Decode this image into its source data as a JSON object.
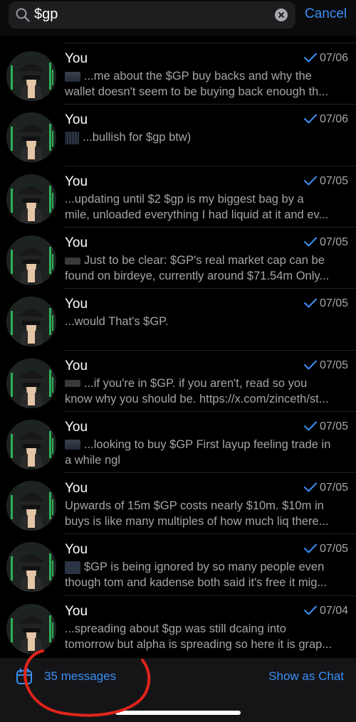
{
  "search": {
    "query": "$gp",
    "cancel_label": "Cancel"
  },
  "results": [
    {
      "sender": "You",
      "date": "07/06",
      "thumb": "t1",
      "text": "...me about the $GP buy backs and why the\nwallet doesn't seem to be buying back enough th..."
    },
    {
      "sender": "You",
      "date": "07/06",
      "thumb": "t2",
      "text": "...bullish for $gp btw)"
    },
    {
      "sender": "You",
      "date": "07/05",
      "thumb": "",
      "text": "...updating until $2 $gp is my biggest bag by a\nmile, unloaded everything I had liquid at it and ev..."
    },
    {
      "sender": "You",
      "date": "07/05",
      "thumb": "t3",
      "text": "Just to be clear: $GP's real market cap can be\nfound on birdeye, currently around $71.54m Only..."
    },
    {
      "sender": "You",
      "date": "07/05",
      "thumb": "",
      "text": "...would That's $GP."
    },
    {
      "sender": "You",
      "date": "07/05",
      "thumb": "t3",
      "text": "...if you're in $GP. if you aren't, read so you\nknow why you should be. https://x.com/zinceth/st..."
    },
    {
      "sender": "You",
      "date": "07/05",
      "thumb": "t1",
      "text": "...looking to buy $GP First layup feeling trade in\na while ngl"
    },
    {
      "sender": "You",
      "date": "07/05",
      "thumb": "",
      "text": "Upwards of 15m $GP costs nearly $10m. $10m in\nbuys is like many multiples of how much liq there..."
    },
    {
      "sender": "You",
      "date": "07/05",
      "thumb": "t4",
      "text": "$GP is being ignored by so many people even\nthough tom and kadense both said it's free it mig..."
    },
    {
      "sender": "You",
      "date": "07/04",
      "thumb": "",
      "text": "...spreading about $gp was still dcaing into\ntomorrow but alpha is spreading so here it is grap..."
    }
  ],
  "footer": {
    "count_label": "35 messages",
    "show_as_chat_label": "Show as Chat"
  },
  "colors": {
    "accent": "#3b8ff6",
    "annotation": "#e0241b"
  }
}
